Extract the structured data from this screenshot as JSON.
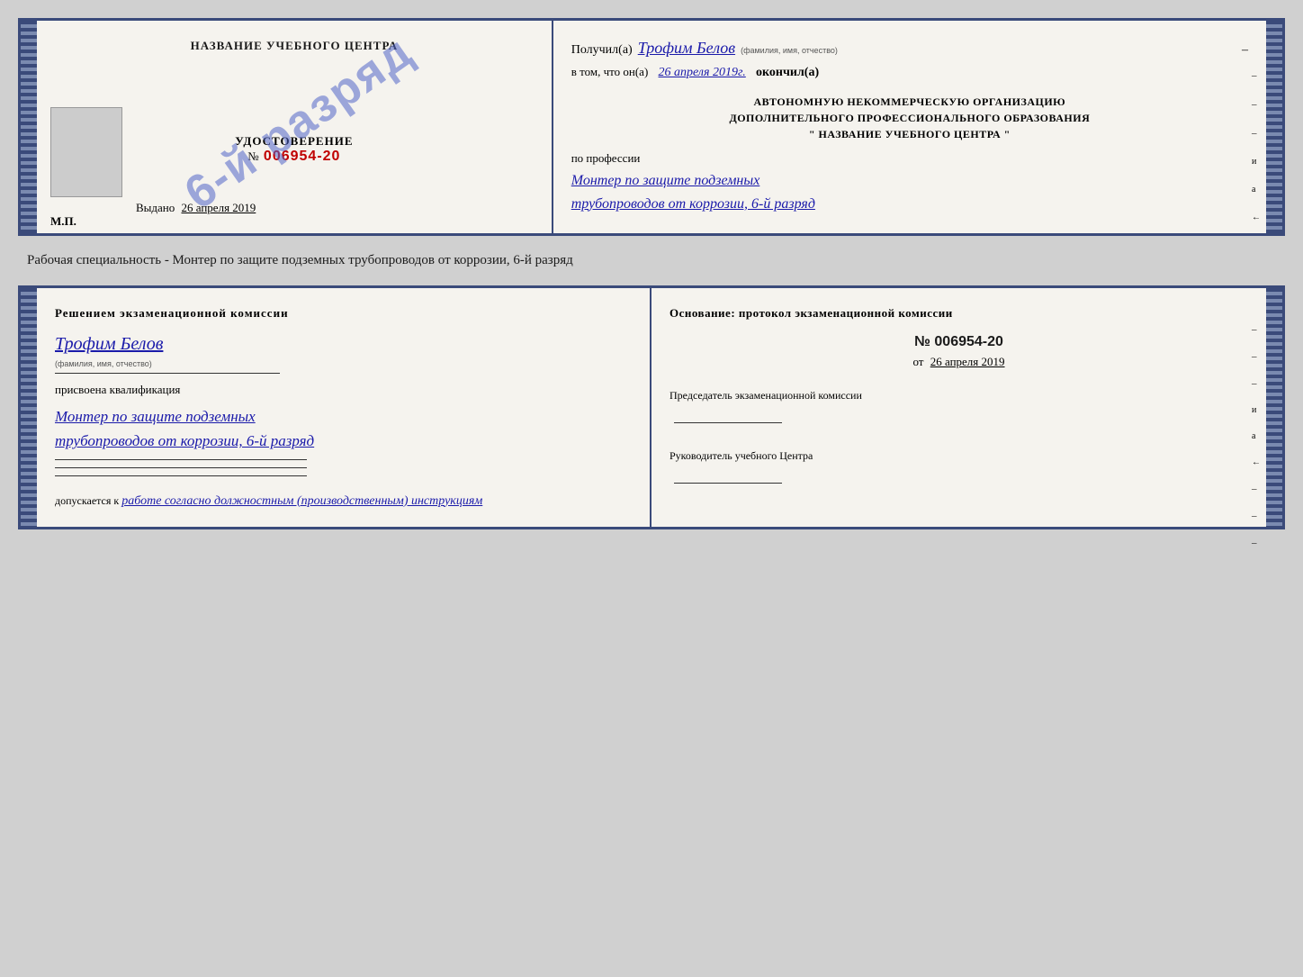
{
  "top_cert": {
    "left": {
      "title": "НАЗВАНИЕ УЧЕБНОГО ЦЕНТРА",
      "stamp": "6-й разряд",
      "udostoverenie_label": "УДОСТОВЕРЕНИЕ",
      "number_prefix": "№",
      "number": "006954-20",
      "vydano_label": "Выдано",
      "vydano_date": "26 апреля 2019",
      "mp_label": "М.П."
    },
    "right": {
      "poluchil_label": "Получил(а)",
      "name": "Трофим Белов",
      "fio_small": "(фамилия, имя, отчество)",
      "dash1": "–",
      "vtom_label": "в том, что он(а)",
      "date_handwritten": "26 апреля 2019г.",
      "okochil_label": "окончил(а)",
      "org_line1": "АВТОНОМНУЮ НЕКОММЕРЧЕСКУЮ ОРГАНИЗАЦИЮ",
      "org_line2": "ДОПОЛНИТЕЛЬНОГО ПРОФЕССИОНАЛЬНОГО ОБРАЗОВАНИЯ",
      "org_line3": "\"  НАЗВАНИЕ УЧЕБНОГО ЦЕНТРА  \"",
      "i_label": "и",
      "a_label": "а",
      "arrow_label": "←",
      "po_professii": "по профессии",
      "profession_line1": "Монтер по защите подземных",
      "profession_line2": "трубопроводов от коррозии, 6-й разряд"
    }
  },
  "middle": {
    "text": "Рабочая специальность - Монтер по защите подземных трубопроводов от коррозии, 6-й разряд"
  },
  "bottom_cert": {
    "left": {
      "resheniem_title": "Решением экзаменационной комиссии",
      "name": "Трофим Белов",
      "fio_small": "(фамилия, имя, отчество)",
      "prisvoena_label": "присвоена квалификация",
      "profession_line1": "Монтер по защите подземных",
      "profession_line2": "трубопроводов от коррозии, 6-й разряд",
      "dopuskaetsya_label": "допускается к",
      "dopuskaetsya_text": "работе согласно должностным (производственным) инструкциям"
    },
    "right": {
      "osnovanie_title": "Основание: протокол экзаменационной комиссии",
      "number_prefix": "№",
      "number": "006954-20",
      "ot_prefix": "от",
      "ot_date": "26 апреля 2019",
      "predsedatel_label": "Председатель экзаменационной комиссии",
      "rukovoditel_label": "Руководитель учебного Центра",
      "side_labels": [
        "-",
        "-",
        "-",
        "и",
        "а",
        "←",
        "-",
        "-",
        "-"
      ]
    }
  }
}
